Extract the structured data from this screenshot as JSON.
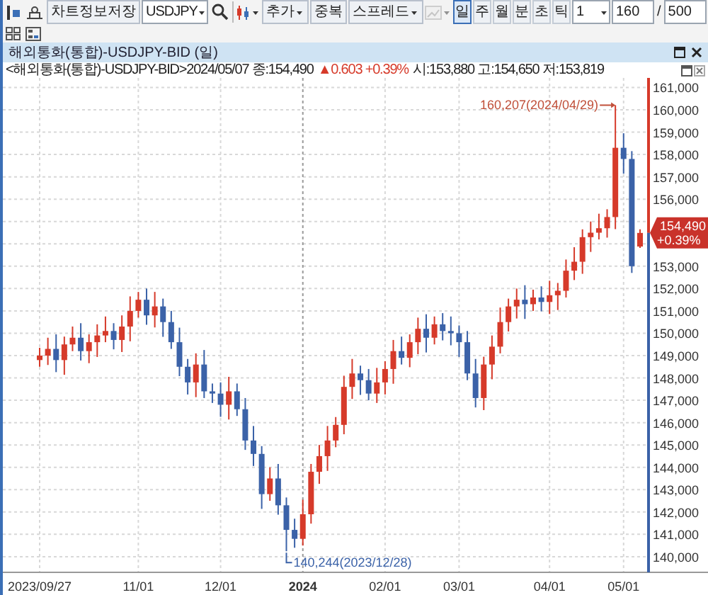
{
  "toolbar": {
    "save_button": "차트정보저장",
    "symbol": "USDJPY",
    "add_menu": "추가",
    "overlap_button": "중복",
    "spread_menu": "스프레드",
    "periods": [
      {
        "label": "일",
        "selected": true
      },
      {
        "label": "주",
        "selected": false
      },
      {
        "label": "월",
        "selected": false
      },
      {
        "label": "분",
        "selected": false
      },
      {
        "label": "초",
        "selected": false
      },
      {
        "label": "틱",
        "selected": false
      }
    ],
    "interval": "1",
    "count": "160",
    "separator": "/",
    "total": "500"
  },
  "panel": {
    "title": "해외통화(통합)-USDJPY-BID (일)",
    "info_prefix": "<해외통화(통합)-USDJPY-BID>2024/05/07 종:154,490",
    "change": "▲0.603 +0.39%",
    "info_rest": "시:153,880 고:154,650 저:153,819"
  },
  "chart_data": {
    "type": "candlestick",
    "categories": [
      "2023/09/27",
      null,
      null,
      null,
      null,
      null,
      null,
      null,
      null,
      null,
      null,
      null,
      "11/01",
      null,
      null,
      null,
      null,
      null,
      null,
      null,
      null,
      null,
      "12/01",
      null,
      null,
      null,
      null,
      null,
      null,
      null,
      null,
      null,
      "2024",
      null,
      null,
      null,
      null,
      null,
      null,
      null,
      null,
      null,
      "02/01",
      null,
      null,
      null,
      null,
      null,
      null,
      null,
      null,
      "03/01",
      null,
      null,
      null,
      null,
      null,
      null,
      null,
      null,
      null,
      null,
      "04/01",
      null,
      null,
      null,
      null,
      null,
      null,
      null,
      null,
      "05/01",
      null,
      null
    ],
    "ohlc": [
      [
        148800,
        149350,
        148500,
        149000
      ],
      [
        149000,
        149800,
        148580,
        149300
      ],
      [
        149300,
        149950,
        148260,
        148800
      ],
      [
        148800,
        149850,
        148140,
        149500
      ],
      [
        149500,
        150300,
        149200,
        149800
      ],
      [
        149800,
        150450,
        148780,
        149200
      ],
      [
        149200,
        149950,
        148660,
        149600
      ],
      [
        149600,
        150400,
        148940,
        149900
      ],
      [
        149900,
        150750,
        149600,
        150100
      ],
      [
        150100,
        150450,
        149280,
        149700
      ],
      [
        149700,
        150800,
        149160,
        150300
      ],
      [
        150300,
        151650,
        149640,
        151000
      ],
      [
        151000,
        151850,
        150700,
        151500
      ],
      [
        151500,
        152000,
        150380,
        150800
      ],
      [
        150800,
        151850,
        150260,
        151200
      ],
      [
        151200,
        151550,
        149840,
        150500
      ],
      [
        150500,
        151000,
        149300,
        149600
      ],
      [
        149600,
        150250,
        148080,
        148500
      ],
      [
        148500,
        148850,
        147260,
        147800
      ],
      [
        147800,
        149100,
        147140,
        148600
      ],
      [
        148600,
        149250,
        147100,
        147400
      ],
      [
        147400,
        147750,
        146880,
        147300
      ],
      [
        147300,
        147800,
        146260,
        146800
      ],
      [
        146800,
        148050,
        146140,
        147400
      ],
      [
        147400,
        147750,
        146300,
        146600
      ],
      [
        146600,
        147100,
        144780,
        145200
      ],
      [
        145200,
        145850,
        144060,
        144600
      ],
      [
        144600,
        144950,
        142140,
        142800
      ],
      [
        142800,
        144000,
        142500,
        143500
      ],
      [
        143500,
        144150,
        141880,
        142300
      ],
      [
        142300,
        142650,
        140244,
        141200
      ],
      [
        141200,
        141700,
        140400,
        140800
      ],
      [
        140800,
        142550,
        140500,
        141900
      ],
      [
        141900,
        144150,
        141480,
        143800
      ],
      [
        143800,
        145000,
        143260,
        144500
      ],
      [
        144500,
        145850,
        143840,
        145200
      ],
      [
        145200,
        146250,
        144900,
        145900
      ],
      [
        145900,
        148100,
        145480,
        147600
      ],
      [
        147600,
        148850,
        147060,
        148200
      ],
      [
        148200,
        148550,
        147240,
        147900
      ],
      [
        147900,
        148400,
        147000,
        147300
      ],
      [
        147300,
        148450,
        146880,
        147800
      ],
      [
        147800,
        148750,
        147260,
        148400
      ],
      [
        148400,
        149700,
        147740,
        149200
      ],
      [
        149200,
        149850,
        148600,
        148900
      ],
      [
        148900,
        149950,
        148480,
        149600
      ],
      [
        149600,
        150700,
        149060,
        150200
      ],
      [
        150200,
        150850,
        149140,
        149800
      ],
      [
        149800,
        150750,
        149500,
        150400
      ],
      [
        150400,
        150900,
        149680,
        150100
      ],
      [
        150100,
        150750,
        149460,
        150000
      ],
      [
        150000,
        150350,
        148940,
        149600
      ],
      [
        149600,
        150100,
        147900,
        148200
      ],
      [
        148200,
        148850,
        146680,
        147100
      ],
      [
        147100,
        148950,
        146560,
        148600
      ],
      [
        148600,
        149900,
        147940,
        149400
      ],
      [
        149400,
        151150,
        149100,
        150500
      ],
      [
        150500,
        151550,
        150080,
        151200
      ],
      [
        151200,
        152000,
        150660,
        151500
      ],
      [
        151500,
        152150,
        150640,
        151300
      ],
      [
        151300,
        151950,
        151000,
        151600
      ],
      [
        151600,
        152100,
        150980,
        151400
      ],
      [
        151400,
        152350,
        150860,
        151700
      ],
      [
        151700,
        152250,
        151040,
        151900
      ],
      [
        151900,
        153300,
        151600,
        152800
      ],
      [
        152800,
        153850,
        152380,
        153200
      ],
      [
        153200,
        154650,
        152660,
        154300
      ],
      [
        154300,
        155000,
        153640,
        154500
      ],
      [
        154500,
        155350,
        154200,
        154700
      ],
      [
        154700,
        155550,
        154280,
        155200
      ],
      [
        155200,
        160207,
        154660,
        158300
      ],
      [
        158300,
        158950,
        157140,
        157800
      ],
      [
        157800,
        158150,
        152700,
        153000
      ],
      [
        153880,
        154650,
        153819,
        154490
      ]
    ],
    "ylim": [
      139300,
      161300
    ],
    "grid": true,
    "yticks": [
      {
        "value": 161000,
        "label": "161,000"
      },
      {
        "value": 160000,
        "label": "160,000"
      },
      {
        "value": 159000,
        "label": "159,000"
      },
      {
        "value": 158000,
        "label": "158,000"
      },
      {
        "value": 157000,
        "label": "157,000"
      },
      {
        "value": 156000,
        "label": "156,000"
      },
      {
        "value": 153000,
        "label": "153,000"
      },
      {
        "value": 152000,
        "label": "152,000"
      },
      {
        "value": 151000,
        "label": "151,000"
      },
      {
        "value": 150000,
        "label": "150,000"
      },
      {
        "value": 149000,
        "label": "149,000"
      },
      {
        "value": 148000,
        "label": "148,000"
      },
      {
        "value": 147000,
        "label": "147,000"
      },
      {
        "value": 146000,
        "label": "146,000"
      },
      {
        "value": 145000,
        "label": "145,000"
      },
      {
        "value": 144000,
        "label": "144,000"
      },
      {
        "value": 143000,
        "label": "143,000"
      },
      {
        "value": 142000,
        "label": "142,000"
      },
      {
        "value": 141000,
        "label": "141,000"
      },
      {
        "value": 140000,
        "label": "140,000"
      }
    ],
    "annotations": [
      "160,207(2024/04/29)",
      "140,244(2023/12/28)"
    ]
  },
  "price_marker": {
    "label": "154,490",
    "change": "+0.39%"
  }
}
